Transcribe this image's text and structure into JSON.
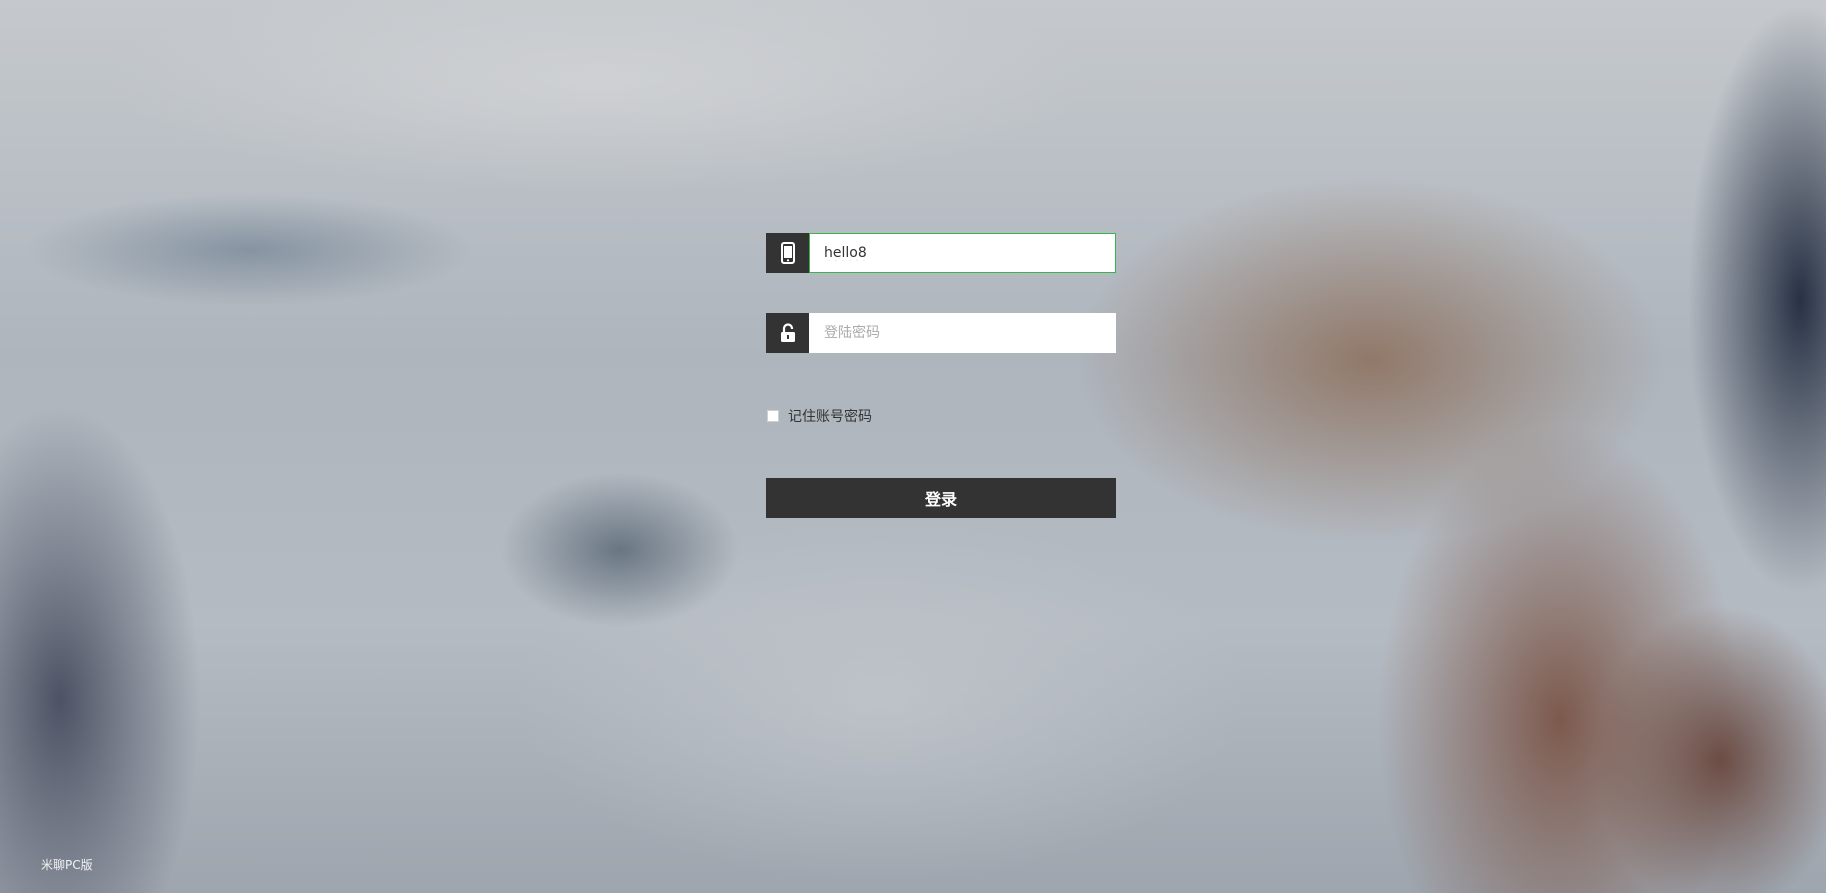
{
  "login": {
    "username_value": "hello8",
    "username_placeholder": "",
    "password_value": "",
    "password_placeholder": "登陆密码",
    "remember_label": "记住账号密码",
    "remember_checked": false,
    "login_button_label": "登录"
  },
  "icons": {
    "username": "mobile-phone-icon",
    "password": "unlock-icon"
  },
  "footer": {
    "label": "米聊PC版"
  },
  "colors": {
    "icon_box": "#333333",
    "button": "#333333",
    "focus_border": "#3bb44a"
  }
}
